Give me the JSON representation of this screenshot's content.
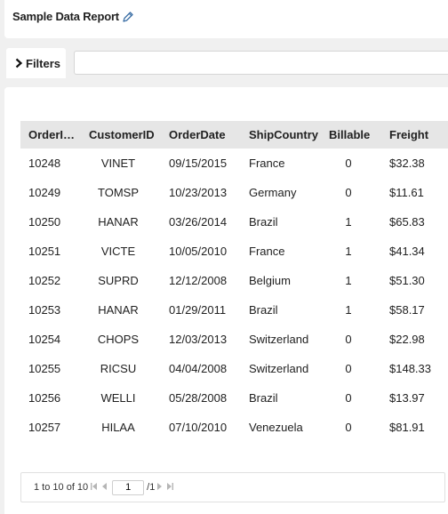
{
  "report": {
    "title": "Sample Data Report"
  },
  "filters": {
    "label": "Filters",
    "input_value": ""
  },
  "grid": {
    "columns": [
      "OrderID...",
      "CustomerID",
      "OrderDate",
      "ShipCountry",
      "Billable",
      "Freight"
    ],
    "rows": [
      [
        "10248",
        "VINET",
        "09/15/2015",
        "France",
        "0",
        "$32.38"
      ],
      [
        "10249",
        "TOMSP",
        "10/23/2013",
        "Germany",
        "0",
        "$11.61"
      ],
      [
        "10250",
        "HANAR",
        "03/26/2014",
        "Brazil",
        "1",
        "$65.83"
      ],
      [
        "10251",
        "VICTE",
        "10/05/2010",
        "France",
        "1",
        "$41.34"
      ],
      [
        "10252",
        "SUPRD",
        "12/12/2008",
        "Belgium",
        "1",
        "$51.30"
      ],
      [
        "10253",
        "HANAR",
        "01/29/2011",
        "Brazil",
        "1",
        "$58.17"
      ],
      [
        "10254",
        "CHOPS",
        "12/03/2013",
        "Switzerland",
        "0",
        "$22.98"
      ],
      [
        "10255",
        "RICSU",
        "04/04/2008",
        "Switzerland",
        "0",
        "$148.33"
      ],
      [
        "10256",
        "WELLI",
        "05/28/2008",
        "Brazil",
        "0",
        "$13.97"
      ],
      [
        "10257",
        "HILAA",
        "07/10/2010",
        "Venezuela",
        "0",
        "$81.91"
      ]
    ]
  },
  "pager": {
    "summary": "1 to 10 of 10",
    "page_value": "1",
    "page_total": "/1"
  },
  "icons": {
    "edit": "pencil-icon",
    "filters_toggle": "chevron-right-icon",
    "first": "first-page-icon",
    "prev": "previous-page-icon",
    "next": "next-page-icon",
    "last": "last-page-icon"
  }
}
